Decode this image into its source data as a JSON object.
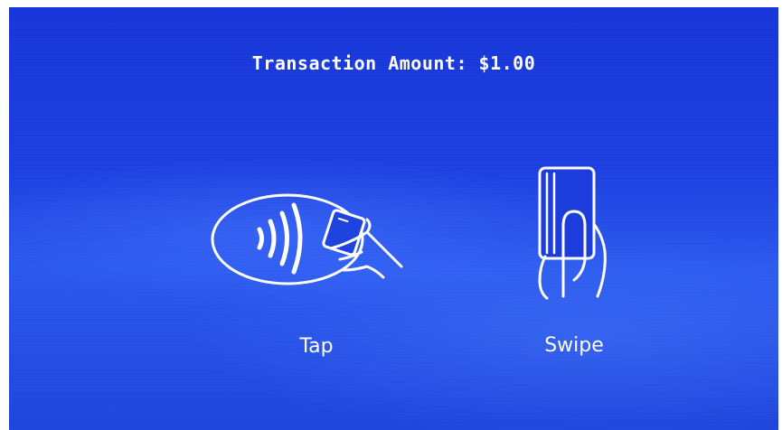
{
  "transaction": {
    "amount_text": "Transaction Amount: $1.00"
  },
  "payment_options": {
    "tap": {
      "label": "Tap",
      "icon": "contactless-tap-icon"
    },
    "swipe": {
      "label": "Swipe",
      "icon": "card-swipe-icon"
    }
  },
  "colors": {
    "screen_background": "#1d3fe0",
    "foreground": "#ffffff"
  }
}
